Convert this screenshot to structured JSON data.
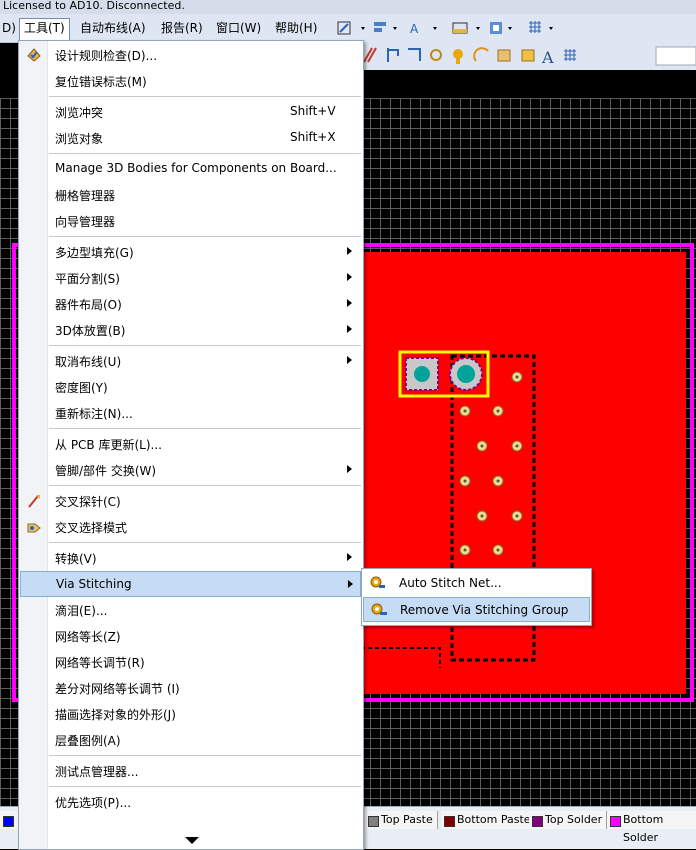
{
  "titlebar": {
    "text": "Licensed to AD10. Disconnected."
  },
  "menubar": {
    "items": [
      {
        "label": "D)"
      },
      {
        "label": "工具(T)"
      },
      {
        "label": "自动布线(A)"
      },
      {
        "label": "报告(R)"
      },
      {
        "label": "窗口(W)"
      },
      {
        "label": "帮助(H)"
      }
    ]
  },
  "tools_menu": {
    "items": [
      {
        "label": "设计规则检查(D)...",
        "shortcut": ""
      },
      {
        "label": "复位错误标志(M)",
        "shortcut": ""
      },
      {
        "label": "浏览冲突",
        "shortcut": "Shift+V"
      },
      {
        "label": "浏览对象",
        "shortcut": "Shift+X"
      },
      {
        "label": "Manage 3D Bodies for Components on Board...",
        "shortcut": ""
      },
      {
        "label": "栅格管理器",
        "shortcut": ""
      },
      {
        "label": "向导管理器",
        "shortcut": ""
      },
      {
        "label": "多边型填充(G)",
        "shortcut": ""
      },
      {
        "label": "平面分割(S)",
        "shortcut": ""
      },
      {
        "label": "器件布局(O)",
        "shortcut": ""
      },
      {
        "label": "3D体放置(B)",
        "shortcut": ""
      },
      {
        "label": "取消布线(U)",
        "shortcut": ""
      },
      {
        "label": "密度图(Y)",
        "shortcut": ""
      },
      {
        "label": "重新标注(N)...",
        "shortcut": ""
      },
      {
        "label": "从 PCB 库更新(L)...",
        "shortcut": ""
      },
      {
        "label": "管脚/部件 交换(W)",
        "shortcut": ""
      },
      {
        "label": "交叉探针(C)",
        "shortcut": ""
      },
      {
        "label": "交叉选择模式",
        "shortcut": ""
      },
      {
        "label": "转换(V)",
        "shortcut": ""
      },
      {
        "label": "Via Stitching",
        "shortcut": ""
      },
      {
        "label": "滴泪(E)...",
        "shortcut": ""
      },
      {
        "label": "网络等长(Z)",
        "shortcut": ""
      },
      {
        "label": "网络等长调节(R)",
        "shortcut": ""
      },
      {
        "label": "差分对网络等长调节 (I)",
        "shortcut": ""
      },
      {
        "label": "描画选择对象的外形(J)",
        "shortcut": ""
      },
      {
        "label": "层叠图例(A)",
        "shortcut": ""
      },
      {
        "label": "测试点管理器...",
        "shortcut": ""
      },
      {
        "label": "优先选项(P)...",
        "shortcut": ""
      }
    ]
  },
  "submenu": {
    "items": [
      {
        "label": "Auto Stitch Net..."
      },
      {
        "label": "Remove Via Stitching Group"
      }
    ]
  },
  "layers": [
    {
      "name": "Top Paste",
      "color": "#808080"
    },
    {
      "name": "Bottom Paste",
      "color": "#800000"
    },
    {
      "name": "Top Solder",
      "color": "#800080"
    },
    {
      "name": "Bottom Solder",
      "color": "#ff00ff"
    }
  ],
  "colors": {
    "pcb_red": "#ff0000",
    "outline_magenta": "#ff00ff",
    "selection_yellow": "#ffff00",
    "pad_teal": "#00a39a",
    "highlight": "#c6dcf5"
  }
}
